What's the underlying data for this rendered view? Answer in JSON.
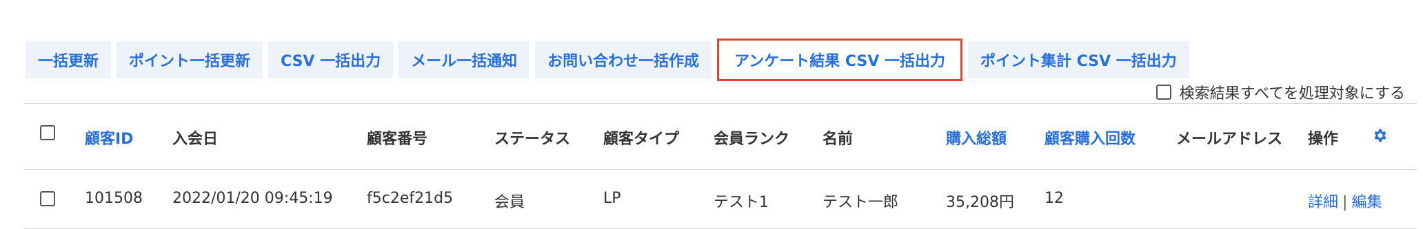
{
  "toolbar": {
    "buttons": [
      {
        "label": "一括更新"
      },
      {
        "label": "ポイント一括更新"
      },
      {
        "label": "CSV 一括出力"
      },
      {
        "label": "メール一括通知"
      },
      {
        "label": "お問い合わせ一括作成"
      },
      {
        "label": "アンケート結果 CSV 一括出力"
      },
      {
        "label": "ポイント集計 CSV 一括出力"
      }
    ],
    "select_all_label": "検索結果すべてを処理対象にする"
  },
  "table": {
    "columns": {
      "customer_id": "顧客ID",
      "join_date": "入会日",
      "customer_number": "顧客番号",
      "status": "ステータス",
      "customer_type": "顧客タイプ",
      "member_rank": "会員ランク",
      "name": "名前",
      "purchase_total": "購入総額",
      "purchase_count": "顧客購入回数",
      "email": "メールアドレス",
      "actions": "操作"
    },
    "rows": [
      {
        "customer_id": "101508",
        "join_date": "2022/01/20 09:45:19",
        "customer_number": "f5c2ef21d5",
        "status": "会員",
        "customer_type": "LP",
        "member_rank": "テスト1",
        "name": "テスト一郎",
        "purchase_total": "35,208円",
        "purchase_count": "12",
        "email": "",
        "detail_label": "詳細",
        "separator": "|",
        "edit_label": "編集"
      }
    ]
  },
  "colors": {
    "accent": "#2a6fd6",
    "highlight_border": "#e04330",
    "button_bg": "#eef3fa"
  },
  "icons": {
    "settings": "gear-icon"
  }
}
